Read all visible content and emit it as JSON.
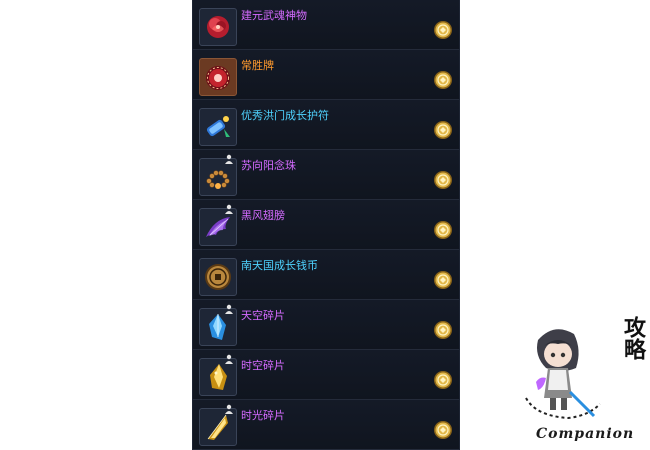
{
  "item_list": {
    "items": [
      {
        "name": "建元武魂神物",
        "color": "#d46bff",
        "icon": "red-rose-icon",
        "frame": "normal",
        "person_marker": false
      },
      {
        "name": "常胜牌",
        "color": "#ff9a2e",
        "icon": "red-medallion-icon",
        "frame": "brown",
        "person_marker": false
      },
      {
        "name": "优秀洪门成长护符",
        "color": "#4fd3ff",
        "icon": "blue-scroll-icon",
        "frame": "normal",
        "person_marker": false
      },
      {
        "name": "苏向阳念珠",
        "color": "#d46bff",
        "icon": "prayer-beads-icon",
        "frame": "normal",
        "person_marker": true
      },
      {
        "name": "黑风翅膀",
        "color": "#d46bff",
        "icon": "purple-wing-icon",
        "frame": "normal",
        "person_marker": true
      },
      {
        "name": "南天国成长钱币",
        "color": "#4fd3ff",
        "icon": "bronze-coin-icon",
        "frame": "normal",
        "person_marker": false
      },
      {
        "name": "天空碎片",
        "color": "#d46bff",
        "icon": "blue-crystal-shard-icon",
        "frame": "normal",
        "person_marker": true
      },
      {
        "name": "时空碎片",
        "color": "#d46bff",
        "icon": "gold-crystal-shard-icon",
        "frame": "normal",
        "person_marker": true
      },
      {
        "name": "时光碎片",
        "color": "#d46bff",
        "icon": "gold-shard-icon",
        "frame": "normal",
        "person_marker": true
      }
    ],
    "action_icon": "gold-coin-icon"
  },
  "watermark": {
    "calligraphy": "攻略",
    "caption": "Companion",
    "icon": "chibi-character-logo"
  }
}
